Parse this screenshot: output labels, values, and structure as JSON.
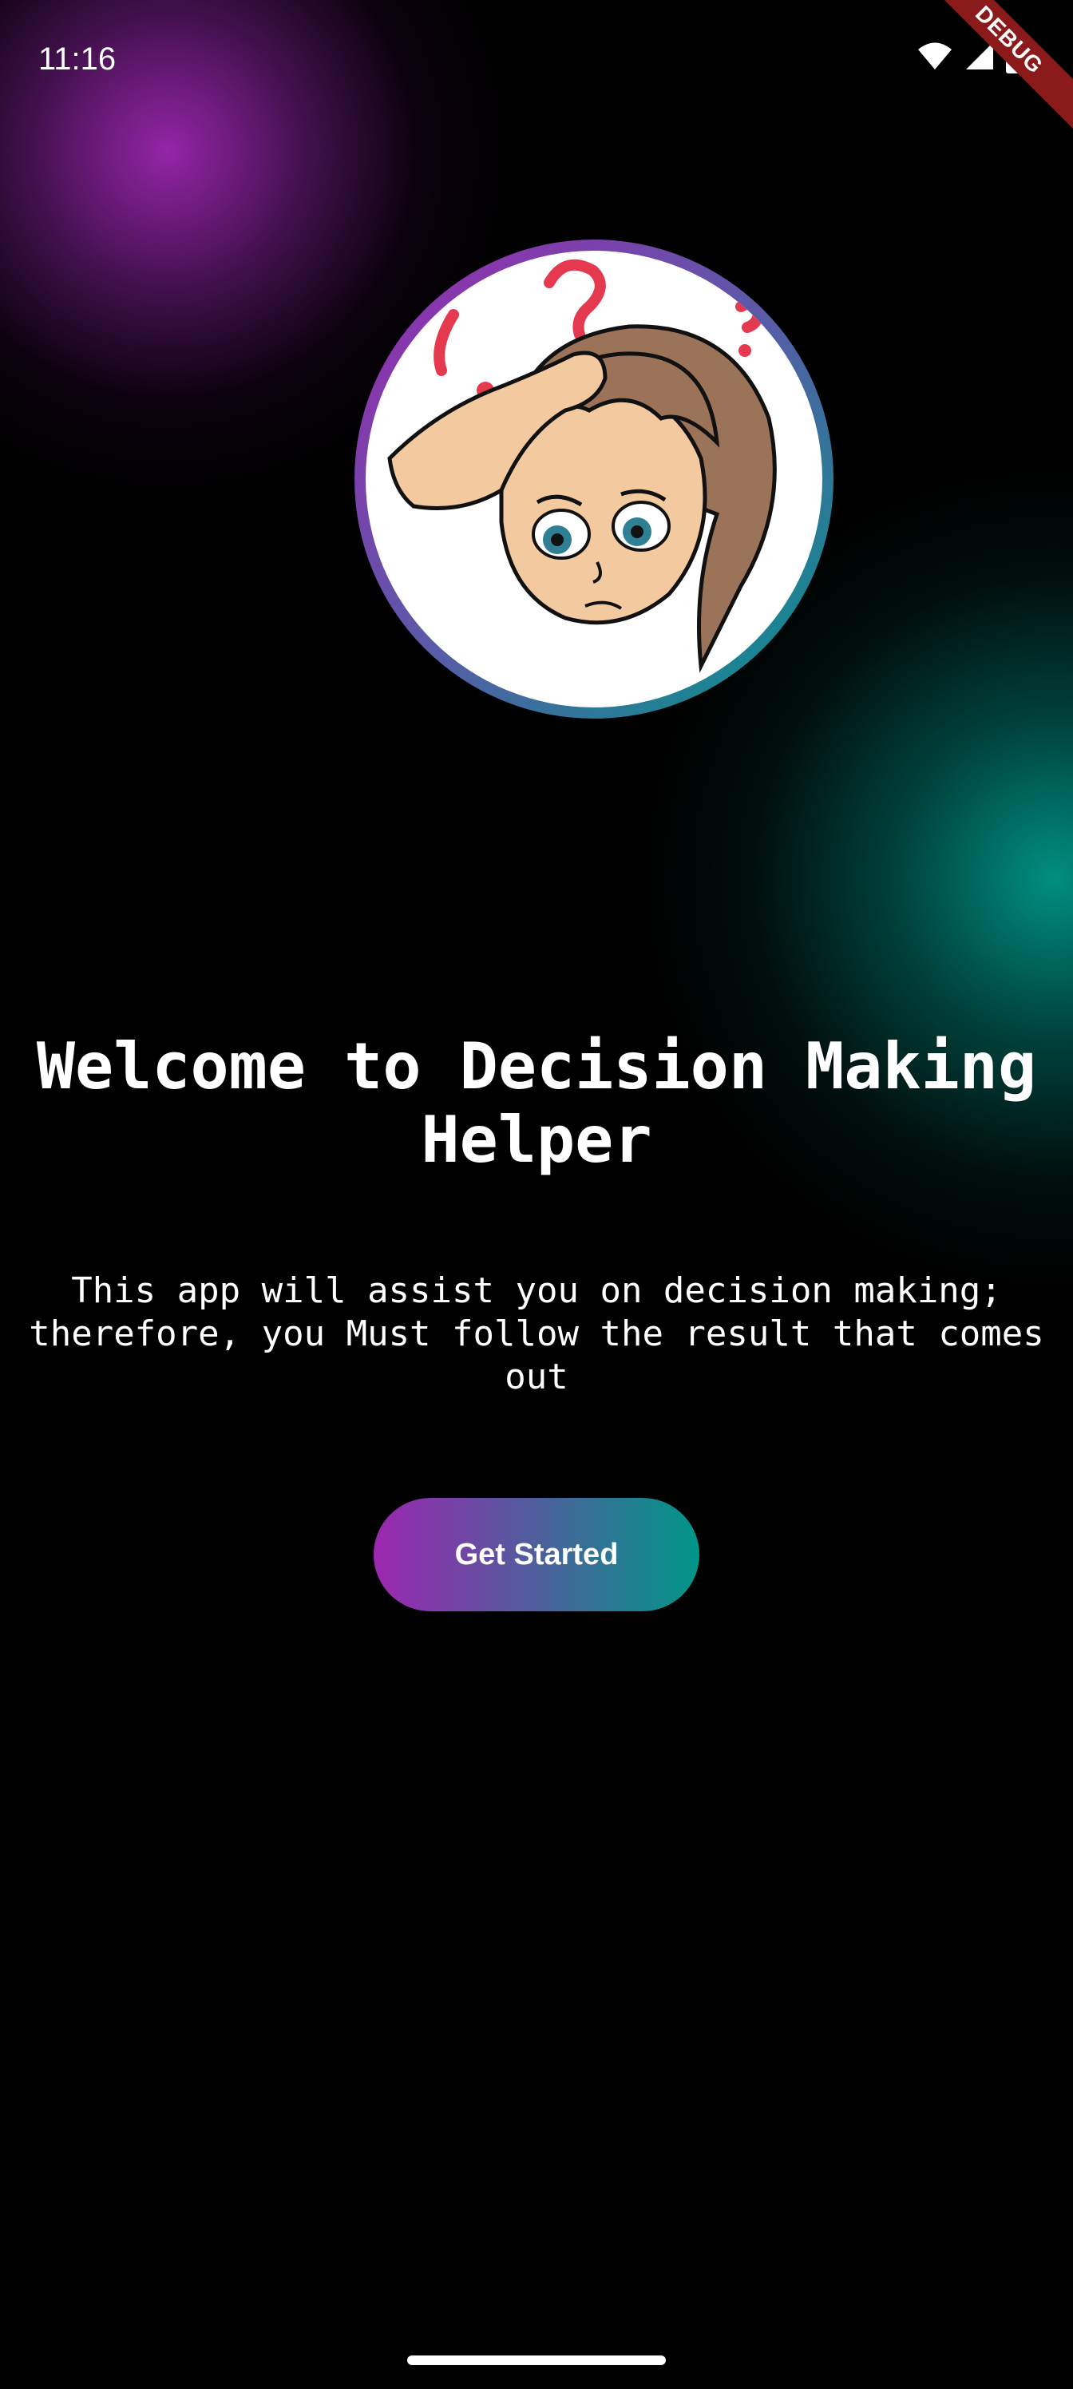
{
  "status_bar": {
    "time": "11:16",
    "icons": [
      "wifi-icon",
      "signal-icon",
      "battery-icon"
    ],
    "debug_banner": "DEBUG"
  },
  "avatar": {
    "icon": "confused-person-illustration",
    "ring_colors": [
      "#9c27b0",
      "#009688"
    ]
  },
  "welcome": {
    "title": "Welcome to Decision Making Helper",
    "description": "This app will assist you on decision making; therefore, you Must follow the result that comes out"
  },
  "cta": {
    "label": "Get Started",
    "gradient": [
      "#9c27b0",
      "#009688"
    ]
  },
  "theme": {
    "background": "#000000",
    "glow_primary": "#9c27b0",
    "glow_secondary": "#009688"
  }
}
